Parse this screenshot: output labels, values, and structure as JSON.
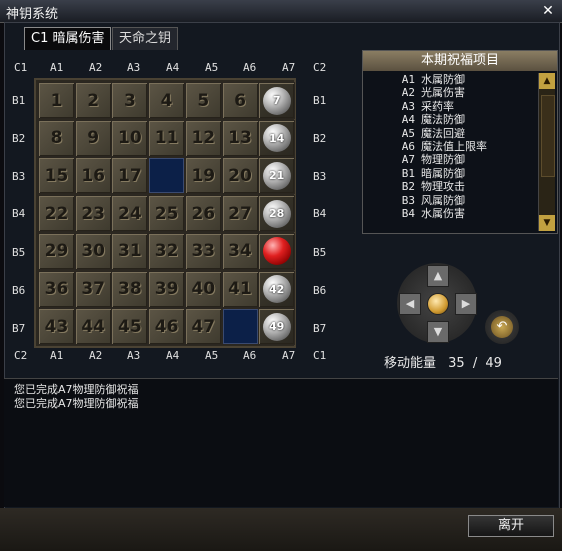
{
  "window": {
    "title": "神钥系统"
  },
  "tabs": [
    {
      "label": "C1 暗属伤害"
    },
    {
      "label": "天命之钥"
    }
  ],
  "board": {
    "columns": [
      "A1",
      "A2",
      "A3",
      "A4",
      "A5",
      "A6",
      "A7"
    ],
    "rows": [
      "B1",
      "B2",
      "B3",
      "B4",
      "B5",
      "B6",
      "B7"
    ],
    "corners": {
      "top_left": "C1",
      "top_right": "C2",
      "bottom_left": "C2",
      "bottom_right": "C1"
    },
    "cells": [
      [
        "1",
        "2",
        "3",
        "4",
        "5",
        "6",
        "7"
      ],
      [
        "8",
        "9",
        "10",
        "11",
        "12",
        "13",
        "14"
      ],
      [
        "15",
        "16",
        "17",
        "",
        "19",
        "20",
        "21"
      ],
      [
        "22",
        "23",
        "24",
        "25",
        "26",
        "27",
        "28"
      ],
      [
        "29",
        "30",
        "31",
        "32",
        "33",
        "34",
        ""
      ],
      [
        "36",
        "37",
        "38",
        "39",
        "40",
        "41",
        "42"
      ],
      [
        "43",
        "44",
        "45",
        "46",
        "47",
        "",
        "49"
      ]
    ],
    "cell_types": [
      [
        "tile",
        "tile",
        "tile",
        "tile",
        "tile",
        "tile",
        "orb"
      ],
      [
        "tile",
        "tile",
        "tile",
        "tile",
        "tile",
        "tile",
        "orb"
      ],
      [
        "tile",
        "tile",
        "tile",
        "blue",
        "tile",
        "tile",
        "orb"
      ],
      [
        "tile",
        "tile",
        "tile",
        "tile",
        "tile",
        "tile",
        "orb"
      ],
      [
        "tile",
        "tile",
        "tile",
        "tile",
        "tile",
        "tile",
        "orb-red"
      ],
      [
        "tile",
        "tile",
        "tile",
        "tile",
        "tile",
        "tile",
        "orb"
      ],
      [
        "tile",
        "tile",
        "tile",
        "tile",
        "tile",
        "blue",
        "orb"
      ]
    ]
  },
  "blessings": {
    "title": "本期祝福项目",
    "items": [
      {
        "code": "A1",
        "name": "水属防御"
      },
      {
        "code": "A2",
        "name": "光属伤害"
      },
      {
        "code": "A3",
        "name": "采药率"
      },
      {
        "code": "A4",
        "name": "魔法防御"
      },
      {
        "code": "A5",
        "name": "魔法回避"
      },
      {
        "code": "A6",
        "name": "魔法值上限率"
      },
      {
        "code": "A7",
        "name": "物理防御"
      },
      {
        "code": "B1",
        "name": "暗属防御"
      },
      {
        "code": "B2",
        "name": "物理攻击"
      },
      {
        "code": "B3",
        "name": "风属防御"
      },
      {
        "code": "B4",
        "name": "水属伤害"
      }
    ]
  },
  "energy": {
    "label": "移动能量",
    "current": "35",
    "separator": "/",
    "max": "49"
  },
  "log": [
    "您已完成A7物理防御祝福",
    "您已完成A7物理防御祝福"
  ],
  "buttons": {
    "leave": "离开"
  },
  "colors": {
    "accent_gold": "#c2a140",
    "tile": "#4e4838",
    "blue_tile": "#0c2048",
    "red_orb": "#e02020"
  }
}
